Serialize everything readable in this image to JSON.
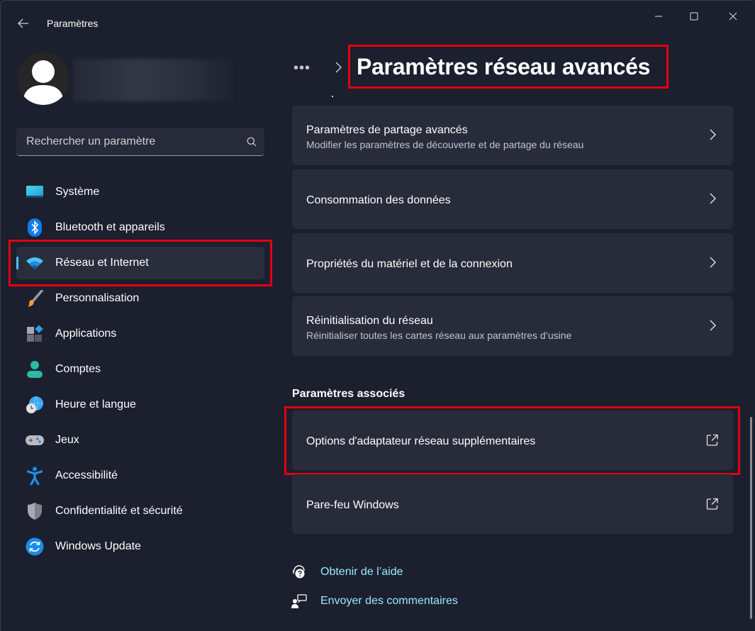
{
  "window": {
    "app_title": "Paramètres",
    "controls": {
      "minimize": "minimize",
      "maximize": "maximize",
      "close": "close"
    }
  },
  "sidebar": {
    "search": {
      "placeholder": "Rechercher un paramètre",
      "value": ""
    },
    "items": [
      {
        "label": "Système",
        "icon": "system-icon",
        "active": false
      },
      {
        "label": "Bluetooth et appareils",
        "icon": "bluetooth-icon",
        "active": false
      },
      {
        "label": "Réseau et Internet",
        "icon": "wifi-icon",
        "active": true
      },
      {
        "label": "Personnalisation",
        "icon": "paintbrush-icon",
        "active": false
      },
      {
        "label": "Applications",
        "icon": "apps-icon",
        "active": false
      },
      {
        "label": "Comptes",
        "icon": "account-icon",
        "active": false
      },
      {
        "label": "Heure et langue",
        "icon": "time-language-icon",
        "active": false
      },
      {
        "label": "Jeux",
        "icon": "gamepad-icon",
        "active": false
      },
      {
        "label": "Accessibilité",
        "icon": "accessibility-icon",
        "active": false
      },
      {
        "label": "Confidentialité et sécurité",
        "icon": "shield-icon",
        "active": false
      },
      {
        "label": "Windows Update",
        "icon": "windows-update-icon",
        "active": false
      }
    ]
  },
  "main": {
    "breadcrumb": {
      "more": "•••",
      "current": "Paramètres réseau avancés"
    },
    "cards": [
      {
        "title": "Paramètres de partage avancés",
        "subtitle": "Modifier les paramètres de découverte et de partage du réseau",
        "action": "chevron"
      },
      {
        "title": "Consommation des données",
        "subtitle": "",
        "action": "chevron"
      },
      {
        "title": "Propriétés du matériel et de la connexion",
        "subtitle": "",
        "action": "chevron"
      },
      {
        "title": "Réinitialisation du réseau",
        "subtitle": "Réinitialiser toutes les cartes réseau aux paramètres d’usine",
        "action": "chevron"
      }
    ],
    "related": {
      "title": "Paramètres associés",
      "cards": [
        {
          "title": "Options d'adaptateur réseau supplémentaires",
          "action": "external"
        },
        {
          "title": "Pare-feu Windows",
          "action": "external"
        }
      ]
    },
    "help_links": [
      {
        "label": "Obtenir de l’aide",
        "icon": "help-icon"
      },
      {
        "label": "Envoyer des commentaires",
        "icon": "feedback-icon"
      }
    ]
  },
  "colors": {
    "background": "#1b1f2e",
    "card": "#272b3a",
    "accent": "#4cc2ff",
    "link": "#99ebff",
    "annotation": "#e4000f"
  }
}
